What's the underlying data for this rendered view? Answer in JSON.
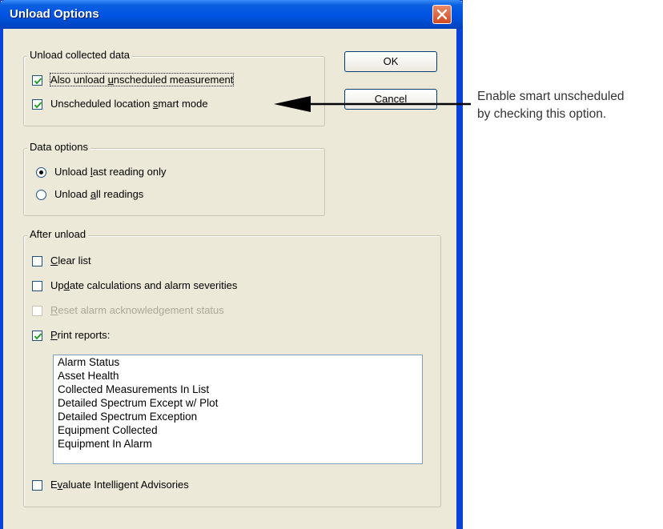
{
  "window": {
    "title": "Unload Options"
  },
  "buttons": {
    "ok": "OK",
    "cancel": "Cancel"
  },
  "unload_group": {
    "legend": "Unload collected data",
    "also_unload": {
      "pre": "Also unload ",
      "accel": "u",
      "post": "nscheduled measurement",
      "checked": true
    },
    "smart_mode": {
      "pre": "Unscheduled location ",
      "accel": "s",
      "post": "mart mode",
      "checked": true
    }
  },
  "data_options": {
    "legend": "Data options",
    "last_reading": {
      "pre": "Unload ",
      "accel": "l",
      "post": "ast reading only",
      "selected": true
    },
    "all_readings": {
      "pre": "Unload ",
      "accel": "a",
      "post": "ll readings",
      "selected": false
    }
  },
  "after_unload": {
    "legend": "After unload",
    "clear_list": {
      "pre": "",
      "accel": "C",
      "post": "lear list",
      "checked": false
    },
    "update_calc": {
      "pre": "Up",
      "accel": "d",
      "post": "ate calculations and alarm severities",
      "checked": false
    },
    "reset_alarm": {
      "pre": "",
      "accel": "R",
      "post": "eset alarm acknowledgement status",
      "checked": false,
      "disabled": true
    },
    "print_reports": {
      "pre": "",
      "accel": "P",
      "post": "rint reports:",
      "checked": true
    },
    "evaluate": {
      "pre": "E",
      "accel": "v",
      "post": "aluate Intelligent Advisories",
      "checked": false
    }
  },
  "reports": [
    "Alarm Status",
    "Asset Health",
    "Collected Measurements In List",
    "Detailed Spectrum Except w/ Plot",
    "Detailed Spectrum Exception",
    "Equipment Collected",
    "Equipment In Alarm"
  ],
  "annotation": {
    "line1": "Enable smart unscheduled",
    "line2": "by checking this option."
  },
  "colors": {
    "titlebar": "#0054e3",
    "dialog_bg": "#ece9d8",
    "frame": "#0842d8"
  }
}
